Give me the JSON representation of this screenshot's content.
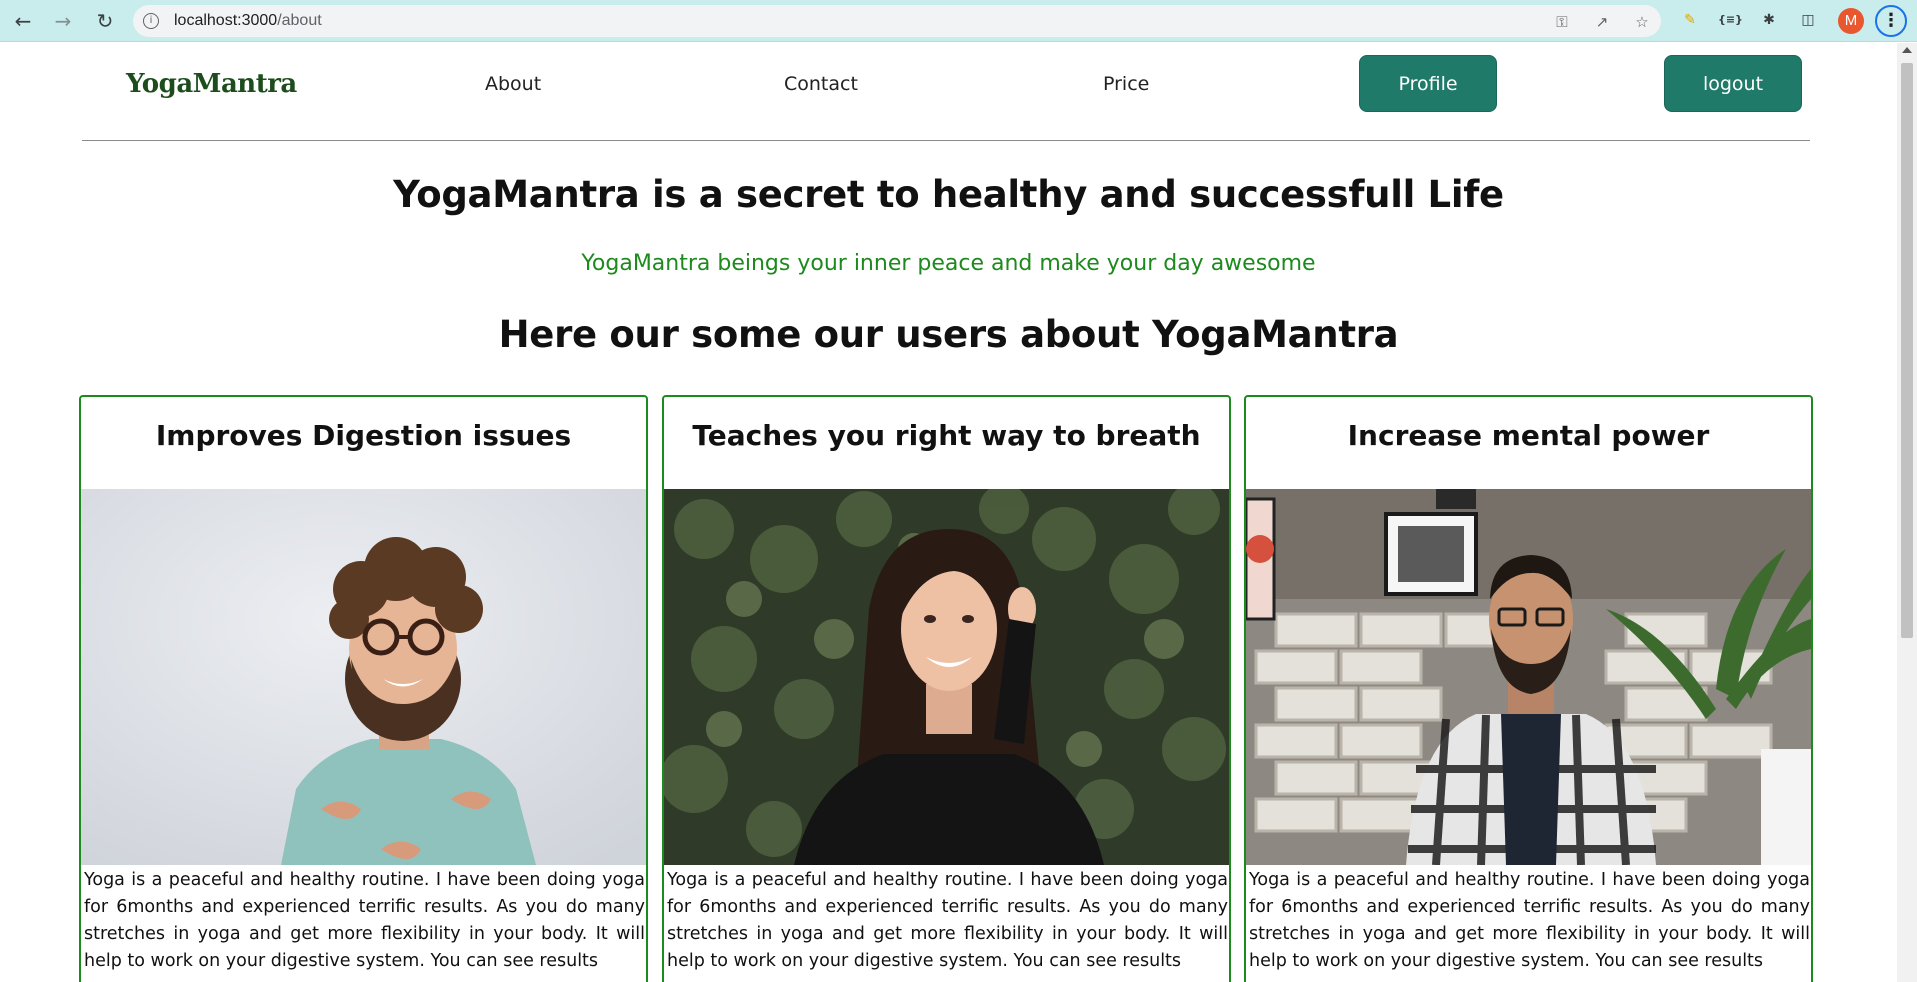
{
  "browser": {
    "url_host": "localhost:3000",
    "url_path": "/about",
    "profile_initial": "M"
  },
  "header": {
    "logo": "YogaMantra",
    "nav": [
      {
        "label": "About"
      },
      {
        "label": "Contact"
      },
      {
        "label": "Price"
      }
    ],
    "profile_label": "Profile",
    "logout_label": "logout"
  },
  "main": {
    "title": "YogaMantra is a secret to healthy and successfull Life",
    "subtitle": "YogaMantra beings your inner peace and make your day awesome",
    "testimonials_heading": "Here our some our users about YogaMantra",
    "cards": [
      {
        "title": "Improves Digestion issues",
        "image": "photo-curly-haired-man-glasses",
        "text": "Yoga is a peaceful and healthy routine. I have been doing yoga for 6months and experienced terrific results. As you do many stretches in yoga and get more flexibility in your body. It will help to work on your digestive system. You can see results"
      },
      {
        "title": "Teaches you right way to breath",
        "image": "photo-smiling-woman-ivy-background",
        "text": "Yoga is a peaceful and healthy routine. I have been doing yoga for 6months and experienced terrific results. As you do many stretches in yoga and get more flexibility in your body. It will help to work on your digestive system. You can see results"
      },
      {
        "title": "Increase mental power",
        "image": "photo-man-plaid-shirt-brick-wall",
        "text": "Yoga is a peaceful and healthy routine. I have been doing yoga for 6months and experienced terrific results. As you do many stretches in yoga and get more flexibility in your body. It will help to work on your digestive system. You can see results"
      }
    ]
  },
  "colors": {
    "brand_green": "#1d4d1d",
    "button_teal": "#1f7a6a",
    "card_border": "#1c8a1c",
    "subtitle_green": "#1c8a1c"
  }
}
